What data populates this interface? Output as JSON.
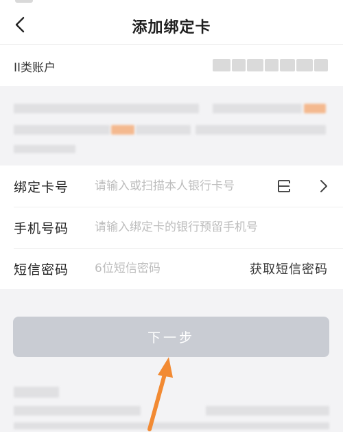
{
  "header": {
    "title": "添加绑定卡",
    "back_icon": "chevron-left-icon"
  },
  "account": {
    "label": "II类账户"
  },
  "form": {
    "card_number": {
      "label": "绑定卡号",
      "placeholder": "请输入或扫描本人银行卡号",
      "scan_icon": "scan-icon",
      "chevron_icon": "chevron-right-icon"
    },
    "phone": {
      "label": "手机号码",
      "placeholder": "请输入绑定卡的银行预留手机号"
    },
    "sms_code": {
      "label": "短信密码",
      "placeholder": "6位短信密码",
      "action_label": "获取短信密码"
    }
  },
  "next_button": {
    "label": "下一步",
    "state": "disabled"
  },
  "annotation": {
    "arrow_color": "#f28a33"
  },
  "colors": {
    "button_disabled": "#c9ccd3",
    "page_background": "#f3f3f5",
    "placeholder": "#bdbdbd"
  }
}
